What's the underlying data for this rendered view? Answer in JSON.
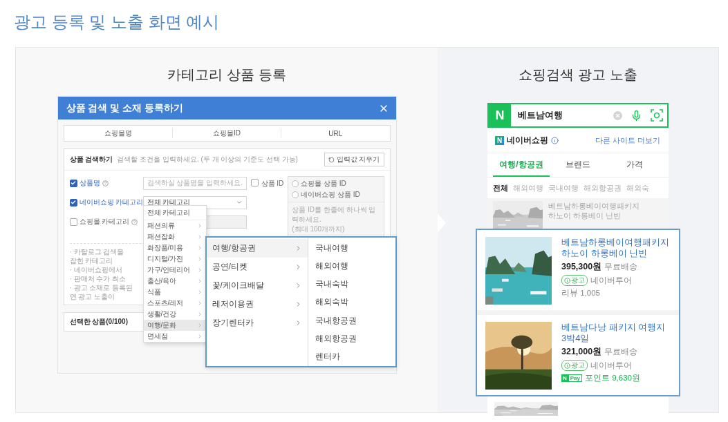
{
  "heading": "광고 등록 및 노출 화면 예시",
  "left_panel": {
    "title": "카테고리 상품 등록",
    "modal": {
      "title": "상품 검색 및 소재 등록하기",
      "tabs": [
        "쇼핑몰명",
        "쇼핑몰ID",
        "URL"
      ],
      "search": {
        "title": "상품 검색하기",
        "description": "검색할 조건을 입력하세요. (두 개 이상의 기준도 선택 가능)",
        "reset_button": "입력값 지우기",
        "criteria": [
          {
            "kind": "text",
            "label": "상품명",
            "checked": true,
            "help": true,
            "disabled": false,
            "placeholder": "검색하실 상품명을 입력하세요."
          },
          {
            "kind": "select",
            "label": "네이버쇼핑 카테고리",
            "checked": true,
            "help": false,
            "disabled": false,
            "value": "전체 카테고리"
          },
          {
            "kind": "text",
            "label": "쇼핑몰 카테고리",
            "checked": false,
            "help": true,
            "disabled": true
          }
        ],
        "id_criterion": {
          "label": "상품 ID",
          "checked": false,
          "options": [
            {
              "label": "쇼핑몰 상품 ID",
              "selected": false
            },
            {
              "label": "네이버쇼핑 상품 ID",
              "selected": false
            }
          ],
          "placeholder": "상품 ID를 한줄에 하나씩 입력하세요.\n(최대 100개까지)"
        },
        "notes": [
          "· 카탈로그 검색을",
          "잡힌 카테고리",
          "· 네이버쇼핑에서",
          "· 판매처 수가 최소",
          "· 광고 소재로 등록된",
          "연 광고 노출이"
        ]
      },
      "selected_products": "선택한 상품(0/100)",
      "category_menu": [
        {
          "label": "전체 카테고리",
          "has_children": false,
          "selected": false
        },
        {
          "label": "패션의류",
          "has_children": true,
          "selected": false
        },
        {
          "label": "패션잡화",
          "has_children": true,
          "selected": false
        },
        {
          "label": "화장품/미용",
          "has_children": true,
          "selected": false
        },
        {
          "label": "디지털/가전",
          "has_children": true,
          "selected": false
        },
        {
          "label": "가구/인테리어",
          "has_children": true,
          "selected": false
        },
        {
          "label": "출산/육아",
          "has_children": true,
          "selected": false
        },
        {
          "label": "식품",
          "has_children": true,
          "selected": false
        },
        {
          "label": "스포츠/레저",
          "has_children": true,
          "selected": false
        },
        {
          "label": "생활/건강",
          "has_children": true,
          "selected": false
        },
        {
          "label": "여행/문화",
          "has_children": true,
          "selected": true
        },
        {
          "label": "면세점",
          "has_children": true,
          "selected": false
        }
      ],
      "submenu": [
        {
          "label": "여행/항공권",
          "selected": true
        },
        {
          "label": "공연/티켓",
          "selected": false
        },
        {
          "label": "꽃/케이크배달",
          "selected": false
        },
        {
          "label": "레저이용권",
          "selected": false
        },
        {
          "label": "장기렌터카",
          "selected": false
        }
      ],
      "submenu_leaves": [
        "국내여행",
        "해외여행",
        "국내숙박",
        "해외숙박",
        "국내항공권",
        "해외항공권",
        "렌터카"
      ]
    }
  },
  "right_panel": {
    "title": "쇼핑검색 광고 노출",
    "search": {
      "logo": "N",
      "value": "베트남여행"
    },
    "shop": {
      "logo": "N",
      "title": "네이버쇼핑",
      "more_link": "다른 사이트 더보기"
    },
    "tabs": [
      {
        "label": "여행/항공권",
        "selected": true
      },
      {
        "label": "브랜드",
        "selected": false
      },
      {
        "label": "가격",
        "selected": false
      }
    ],
    "chips": [
      {
        "label": "전체",
        "selected": true
      },
      {
        "label": "해외여행",
        "selected": false
      },
      {
        "label": "국내여행",
        "selected": false
      },
      {
        "label": "해외항공권",
        "selected": false
      },
      {
        "label": "해외숙",
        "selected": false
      }
    ],
    "faded_item": {
      "title": "베트남하롱베이여행패키지\n하노이 하롱베이 닌빈"
    },
    "ads": [
      {
        "title": "베트남하롱베이여행패키지\n하노이 하롱베이 닌빈",
        "price": "395,300원",
        "shipping": "무료배송",
        "ad_badge": "광고",
        "seller": "네이버투어",
        "extra": {
          "kind": "review",
          "text": "리뷰 1,005"
        }
      },
      {
        "title": "베트남다낭 패키지 여행지\n3박4일",
        "price": "321,000원",
        "shipping": "무료배송",
        "ad_badge": "광고",
        "seller": "네이버투어",
        "extra": {
          "kind": "npay",
          "badge_n": "N",
          "badge_pay": "Pay",
          "text": "포인트 9,630원"
        }
      }
    ]
  }
}
